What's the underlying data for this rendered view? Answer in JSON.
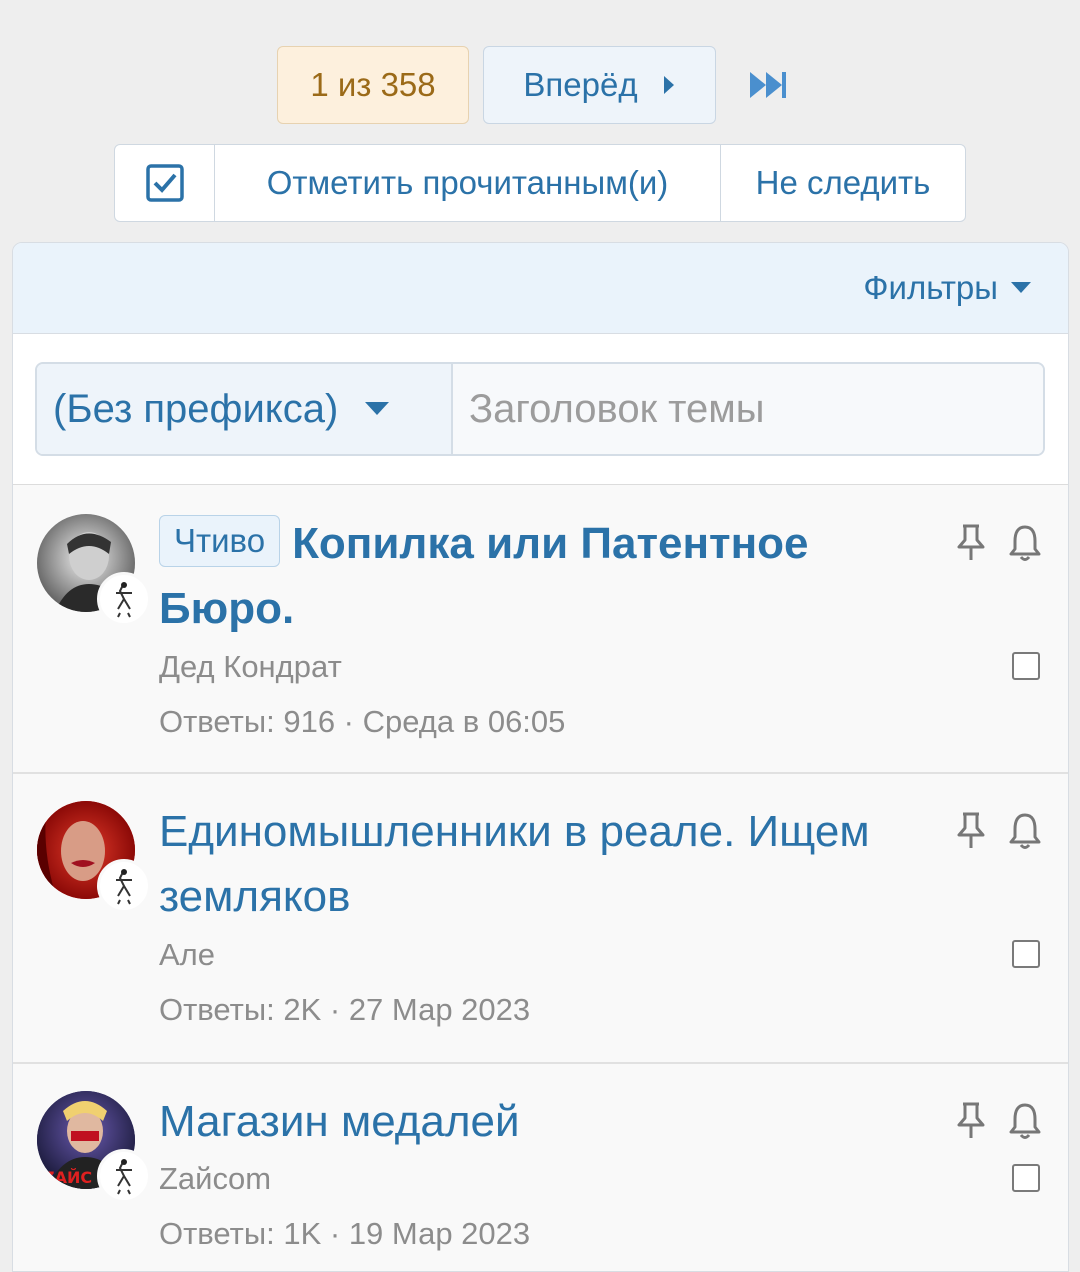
{
  "pagination": {
    "current": "1 из 358",
    "next_label": "Вперёд"
  },
  "actions": {
    "mark_read": "Отметить прочитанным(и)",
    "unwatch": "Не следить"
  },
  "filters": {
    "label": "Фильтры"
  },
  "new_thread": {
    "prefix": "(Без префикса)",
    "title_placeholder": "Заголовок темы"
  },
  "threads": [
    {
      "prefix": "Чтиво",
      "title": "Копилка или Патентное Бюро.",
      "author": "Дед Кондрат",
      "meta": "Ответы: 916 · Среда в 06:05"
    },
    {
      "title": "Единомышленники в реале. Ищем земляков",
      "author": "Але",
      "meta": "Ответы: 2K · 27 Мар 2023"
    },
    {
      "title": "Магазин медалей",
      "author": "Zaйcom",
      "meta": "Ответы: 1K · 19 Мар 2023"
    }
  ],
  "colors": {
    "accent": "#2b72a8",
    "pager_current_bg": "#fdf0dd",
    "panel_header_bg": "#eaf3fb"
  }
}
